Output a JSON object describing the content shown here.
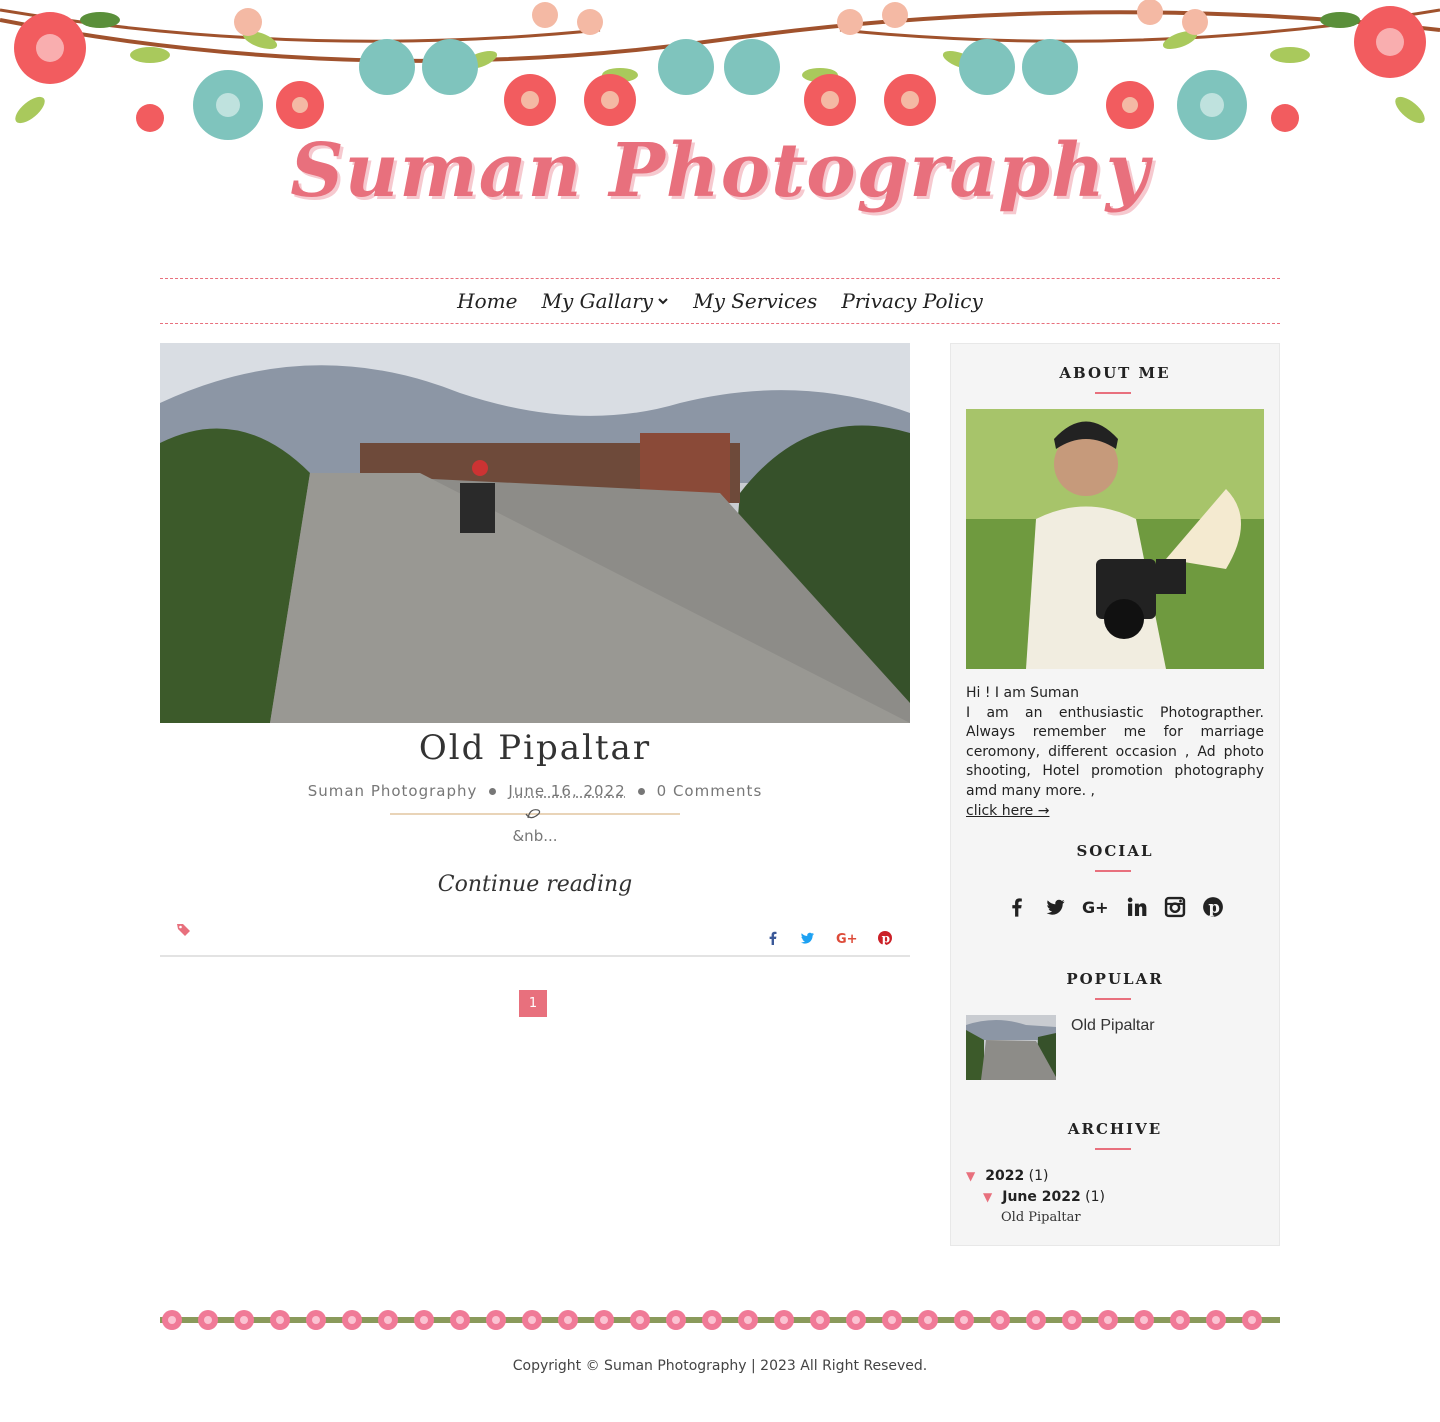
{
  "site": {
    "title": "Suman Photography"
  },
  "nav": {
    "items": [
      {
        "label": "Home"
      },
      {
        "label": "My Gallary"
      },
      {
        "label": "My Services"
      },
      {
        "label": "Privacy Policy"
      }
    ]
  },
  "post": {
    "title": "Old Pipaltar",
    "author": "Suman Photography",
    "date": "June 16, 2022",
    "comments": "0 Comments",
    "excerpt": "&nb...",
    "continue_label": "Continue reading"
  },
  "pagination": {
    "current": "1"
  },
  "sidebar": {
    "about": {
      "title": "ABOUT ME",
      "greeting": "Hi ! I am Suman",
      "body": "I am an enthusiastic Photograpther. Always remember me for marriage ceromony, different occasion , Ad photo shooting, Hotel promotion photography amd many more. ,",
      "link": "click here →"
    },
    "social": {
      "title": "SOCIAL",
      "icons": [
        "facebook-icon",
        "twitter-icon",
        "google-plus-icon",
        "linkedin-icon",
        "instagram-icon",
        "pinterest-icon"
      ]
    },
    "popular": {
      "title": "POPULAR",
      "post_title": "Old Pipaltar"
    },
    "archive": {
      "title": "ARCHIVE",
      "year": "2022",
      "year_count": "(1)",
      "month": "June 2022",
      "month_count": "(1)",
      "post": "Old Pipaltar"
    }
  },
  "footer": {
    "copyright": "Copyright © Suman Photography | 2023 All Right Reseved."
  },
  "colors": {
    "accent": "#e8707d",
    "sidebar_bg": "#f5f5f5",
    "teal_flower": "#7fc4bd",
    "leaf": "#a9c95c"
  }
}
